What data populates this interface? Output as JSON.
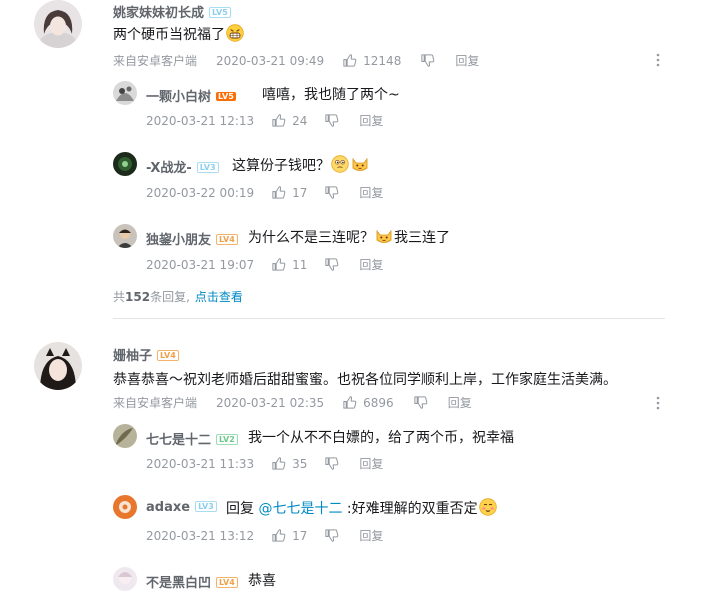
{
  "comments": [
    {
      "user": "姚家妹妹初长成",
      "level": "LV5",
      "text": "两个硬币当祝福了",
      "device": "来自安卓客户端",
      "date": "2020-03-21 09:49",
      "likes": "12148",
      "reply_label": "回复",
      "replies": [
        {
          "user": "一颗小白树",
          "level": "LV5",
          "text": "嘻嘻，我也随了两个~",
          "date": "2020-03-21 12:13",
          "likes": "24",
          "reply_label": "回复"
        },
        {
          "user": "-X战龙-",
          "level": "LV3",
          "text": "这算份子钱吧？",
          "date": "2020-03-22 00:19",
          "likes": "17",
          "reply_label": "回复"
        },
        {
          "user": "独鋆小朋友",
          "level": "LV4",
          "text_a": "为什么不是三连呢？",
          "text_b": "我三连了",
          "date": "2020-03-21 19:07",
          "likes": "11",
          "reply_label": "回复"
        }
      ],
      "total": {
        "prefix": "共",
        "count": "152",
        "suffix": "条回复,",
        "link": "点击查看"
      }
    },
    {
      "user": "姗柚子",
      "level": "LV4",
      "text": "恭喜恭喜～祝刘老师婚后甜甜蜜蜜。也祝各位同学顺利上岸，工作家庭生活美满。",
      "device": "来自安卓客户端",
      "date": "2020-03-21 02:35",
      "likes": "6896",
      "reply_label": "回复",
      "replies": [
        {
          "user": "七七是十二",
          "level": "LV2",
          "text": "我一个从不不白嫖的，给了两个币，祝幸福",
          "date": "2020-03-21 11:33",
          "likes": "35",
          "reply_label": "回复"
        },
        {
          "user": "adaxe",
          "level": "LV3",
          "text_a": "回复 ",
          "mention": "@七七是十二",
          "text_b": " :好难理解的双重否定",
          "date": "2020-03-21 13:12",
          "likes": "17",
          "reply_label": "回复"
        },
        {
          "user": "不是黑白凹",
          "level": "LV4",
          "text": "恭喜"
        }
      ]
    }
  ],
  "icons": {
    "like": "thumbs-up-icon",
    "dislike": "thumbs-down-icon",
    "more": "more-vertical-icon"
  },
  "colors": {
    "username": "#61666d",
    "meta": "#9499a0",
    "link": "#008ac5",
    "lv5": "#ff6c00",
    "lv3": "#8ccfee",
    "lv4": "#f0a14a",
    "lv2": "#6ec98e"
  }
}
